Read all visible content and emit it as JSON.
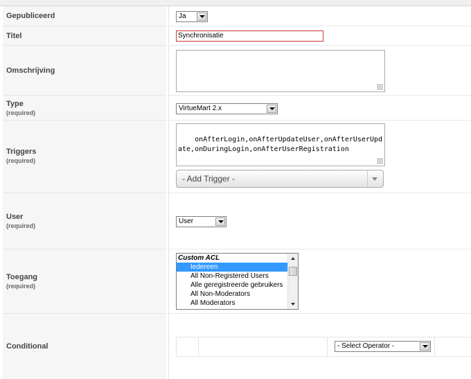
{
  "form": {
    "published": {
      "label": "Gepubliceerd",
      "value": "Ja"
    },
    "title": {
      "label": "Titel",
      "value": "Synchronisatie"
    },
    "description": {
      "label": "Omschrijving",
      "value": ""
    },
    "type": {
      "label": "Type",
      "required": "(required)",
      "value": "VirtueMart 2.x"
    },
    "triggers": {
      "label": "Triggers",
      "required": "(required)",
      "value": "onAfterLogin,onAfterUpdateUser,onAfterUserUpdate,onDuringLogin,onAfterUserRegistration",
      "add_placeholder": "- Add Trigger -"
    },
    "user": {
      "label": "User",
      "required": "(required)",
      "value": "User"
    },
    "access": {
      "label": "Toegang",
      "required": "(required)",
      "group": "Custom ACL",
      "options": [
        "Iedereen",
        "All Non-Registered Users",
        "Alle geregistreerde gebruikers",
        "All Non-Moderators",
        "All Moderators"
      ],
      "selected_index": 0
    },
    "conditional": {
      "label": "Conditional",
      "operator": "- Select Operator -"
    }
  },
  "colors": {
    "selection": "#3399ff",
    "invalid_border": "#cc3333",
    "label_bg": "#f6f6f6"
  }
}
